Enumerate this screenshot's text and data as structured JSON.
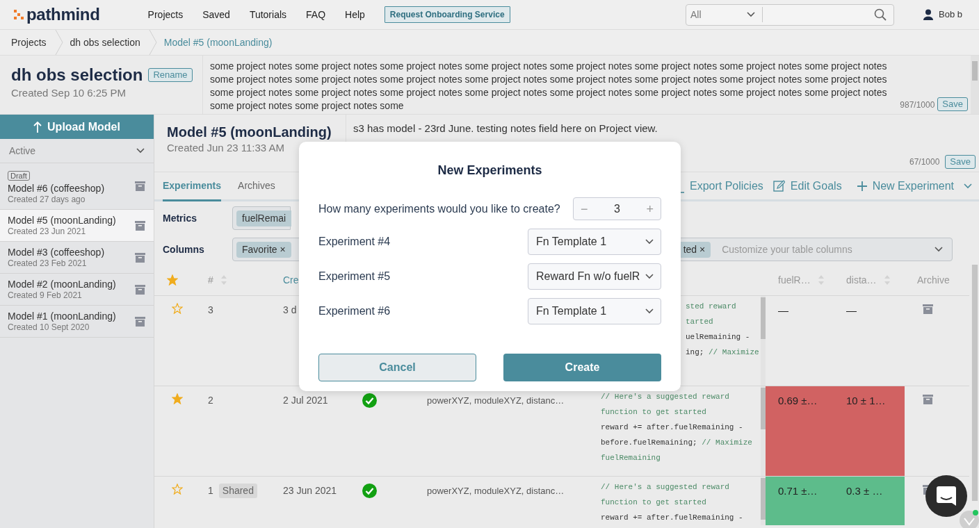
{
  "navbar": {
    "logo": "pathmind",
    "links": [
      {
        "label": "Projects"
      },
      {
        "label": "Saved"
      },
      {
        "label": "Tutorials"
      },
      {
        "label": "FAQ"
      },
      {
        "label": "Help"
      }
    ],
    "onboarding_button": "Request Onboarding Service",
    "search": {
      "scope": "All"
    },
    "user": "Bob b"
  },
  "breadcrumb": [
    {
      "label": "Projects",
      "current": false
    },
    {
      "label": "dh obs selection",
      "current": false
    },
    {
      "label": "Model #5 (moonLanding)",
      "current": true
    }
  ],
  "project": {
    "title": "dh obs selection",
    "rename": "Rename",
    "created": "Created Sep 10 6:25 PM",
    "notes": "some project notes some project notes some project notes some project notes some project notes some project notes some project notes some project notes some project notes some project notes some project notes some project notes some project notes some project notes some project notes some project notes some project notes some project notes some project notes some project notes some project notes some project notes some project notes some project notes some project notes some project notes some",
    "counter": "987/1000",
    "save": "Save"
  },
  "sidebar": {
    "upload": "Upload Model",
    "filter": "Active",
    "models": [
      {
        "badge": "Draft",
        "name": "Model #6 (coffeeshop)",
        "created": "Created 27 days ago",
        "selected": false
      },
      {
        "name": "Model #5 (moonLanding)",
        "created": "Created 23 Jun 2021",
        "selected": true
      },
      {
        "name": "Model #3 (coffeeshop)",
        "created": "Created 23 Feb 2021",
        "selected": false
      },
      {
        "name": "Model #2 (moonLanding)",
        "created": "Created 9 Feb 2021",
        "selected": false
      },
      {
        "name": "Model #1 (moonLanding)",
        "created": "Created 10 Sept 2020",
        "selected": false
      }
    ]
  },
  "model": {
    "title": "Model #5 (moonLanding)",
    "created": "Created Jun 23 11:33 AM",
    "notes": "s3 has model - 23rd June. testing notes field here on Project view.",
    "counter": "67/1000",
    "save": "Save"
  },
  "tabs": [
    {
      "label": "Experiments",
      "selected": true
    },
    {
      "label": "Archives",
      "selected": false
    }
  ],
  "actions": [
    {
      "label": "Export Policies",
      "kind": "export"
    },
    {
      "label": "Edit Goals",
      "kind": "edit"
    },
    {
      "label": "New Experiment",
      "kind": "new"
    }
  ],
  "filters": {
    "metrics_label": "Metrics",
    "metrics_chips": [
      {
        "label": "fuelRemai"
      }
    ],
    "columns_label": "Columns",
    "columns_chips": [
      {
        "label": "Favorite",
        "remove": "×"
      },
      {
        "label": "ted",
        "remove": "×"
      }
    ],
    "columns_placeholder": "Customize your table columns"
  },
  "table": {
    "columns": [
      {
        "kind": "star"
      },
      {
        "label": "#",
        "sortable": true
      },
      {
        "label": "Cre",
        "active": true
      },
      {
        "kind": "covered"
      },
      {
        "kind": "covered"
      },
      {
        "kind": "covered"
      },
      {
        "label": "fuelR…",
        "sortable": true
      },
      {
        "label": "dista…",
        "sortable": true
      },
      {
        "label": "Archive"
      }
    ],
    "rows": [
      {
        "favorite": false,
        "number": "3",
        "created": "3 d",
        "reward_covered": true,
        "reward_lines": [
          [
            {
              "text": "sted reward",
              "kind": "comment"
            }
          ],
          [
            {
              "text": "tarted",
              "kind": "comment"
            }
          ],
          [
            {
              "text": "uelRemaining -",
              "kind": "code"
            }
          ],
          [
            {
              "text": "ing; ",
              "kind": "code"
            },
            {
              "text": "// Maximize",
              "kind": "comment"
            }
          ]
        ],
        "metrics": [
          {
            "text": "—"
          },
          {
            "text": "—"
          }
        ]
      },
      {
        "favorite": true,
        "number": "2",
        "created": "2 Jul 2021",
        "succeeded": true,
        "observations": "powerXYZ, moduleXYZ, distanc…",
        "reward_covered": false,
        "reward_lines": [
          [
            {
              "text": "// Here's a suggested reward",
              "kind": "comment"
            }
          ],
          [
            {
              "text": "function to get started",
              "kind": "comment"
            }
          ],
          [
            {
              "text": "reward += after.fuelRemaining -",
              "kind": "code"
            }
          ],
          [
            {
              "text": "before.fuelRemaining; ",
              "kind": "code"
            },
            {
              "text": "// Maximize",
              "kind": "comment"
            }
          ],
          [
            {
              "text": "fuelRemaining",
              "kind": "comment"
            }
          ]
        ],
        "metrics": [
          {
            "text": "0.69 ±…",
            "color": "#d16262"
          },
          {
            "text": "10 ± 1…",
            "color": "#d16262"
          }
        ]
      },
      {
        "favorite": false,
        "number": "1",
        "badge": "Shared",
        "created": "23 Jun 2021",
        "succeeded": true,
        "observations": "powerXYZ, moduleXYZ, distanc…",
        "reward_covered": false,
        "reward_lines": [
          [
            {
              "text": "// Here's a suggested reward",
              "kind": "comment"
            }
          ],
          [
            {
              "text": "function to get started",
              "kind": "comment"
            }
          ],
          [
            {
              "text": "reward += after.fuelRemaining -",
              "kind": "code"
            }
          ]
        ],
        "metrics": [
          {
            "text": "0.71 ±…",
            "color": "#5dbc8b"
          },
          {
            "text": "0.3 ± …",
            "color": "#5dbc8b"
          }
        ]
      }
    ]
  },
  "modal": {
    "title": "New Experiments",
    "question": "How many experiments would you like to create?",
    "stepper": {
      "minus": "−",
      "value": "3",
      "plus": "+"
    },
    "experiments": [
      {
        "label": "Experiment #4",
        "template": "Fn Template 1"
      },
      {
        "label": "Experiment #5",
        "template": "Reward Fn w/o fuelR"
      },
      {
        "label": "Experiment #6",
        "template": "Fn Template 1"
      }
    ],
    "cancel": "Cancel",
    "create": "Create"
  }
}
